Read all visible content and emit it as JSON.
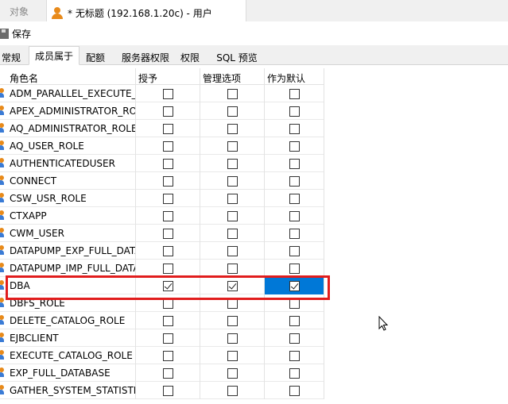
{
  "window_tabs": {
    "objects_label": "对象",
    "active_label": "* 无标题 (192.168.1.20c) - 用户",
    "active_icon": "user-icon"
  },
  "toolbar": {
    "save_label": "保存",
    "save_icon": "floppy-disk-icon"
  },
  "property_tabs": [
    {
      "label": "常规",
      "active": false
    },
    {
      "label": "成员属于",
      "active": true
    },
    {
      "label": "配额",
      "active": false
    },
    {
      "label": "服务器权限",
      "active": false
    },
    {
      "label": "权限",
      "active": false
    },
    {
      "label": "SQL 预览",
      "active": false
    }
  ],
  "grid": {
    "columns": [
      "角色名",
      "授予",
      "管理选项",
      "作为默认"
    ],
    "rows": [
      {
        "name": "ADM_PARALLEL_EXECUTE_T",
        "grant": false,
        "admin": false,
        "default": false
      },
      {
        "name": "APEX_ADMINISTRATOR_RO",
        "grant": false,
        "admin": false,
        "default": false
      },
      {
        "name": "AQ_ADMINISTRATOR_ROLE",
        "grant": false,
        "admin": false,
        "default": false
      },
      {
        "name": "AQ_USER_ROLE",
        "grant": false,
        "admin": false,
        "default": false
      },
      {
        "name": "AUTHENTICATEDUSER",
        "grant": false,
        "admin": false,
        "default": false
      },
      {
        "name": "CONNECT",
        "grant": false,
        "admin": false,
        "default": false
      },
      {
        "name": "CSW_USR_ROLE",
        "grant": false,
        "admin": false,
        "default": false
      },
      {
        "name": "CTXAPP",
        "grant": false,
        "admin": false,
        "default": false
      },
      {
        "name": "CWM_USER",
        "grant": false,
        "admin": false,
        "default": false
      },
      {
        "name": "DATAPUMP_EXP_FULL_DATA",
        "grant": false,
        "admin": false,
        "default": false
      },
      {
        "name": "DATAPUMP_IMP_FULL_DATA",
        "grant": false,
        "admin": false,
        "default": false
      },
      {
        "name": "DBA",
        "grant": true,
        "admin": true,
        "default": true,
        "selected": true
      },
      {
        "name": "DBFS_ROLE",
        "grant": false,
        "admin": false,
        "default": false
      },
      {
        "name": "DELETE_CATALOG_ROLE",
        "grant": false,
        "admin": false,
        "default": false
      },
      {
        "name": "EJBCLIENT",
        "grant": false,
        "admin": false,
        "default": false
      },
      {
        "name": "EXECUTE_CATALOG_ROLE",
        "grant": false,
        "admin": false,
        "default": false
      },
      {
        "name": "EXP_FULL_DATABASE",
        "grant": false,
        "admin": false,
        "default": false
      },
      {
        "name": "GATHER_SYSTEM_STATISTIC",
        "grant": false,
        "admin": false,
        "default": false
      }
    ]
  },
  "colors": {
    "selection": "#0078d7",
    "highlight_border": "#e11d1d",
    "user_icon": "#e88a1a"
  }
}
